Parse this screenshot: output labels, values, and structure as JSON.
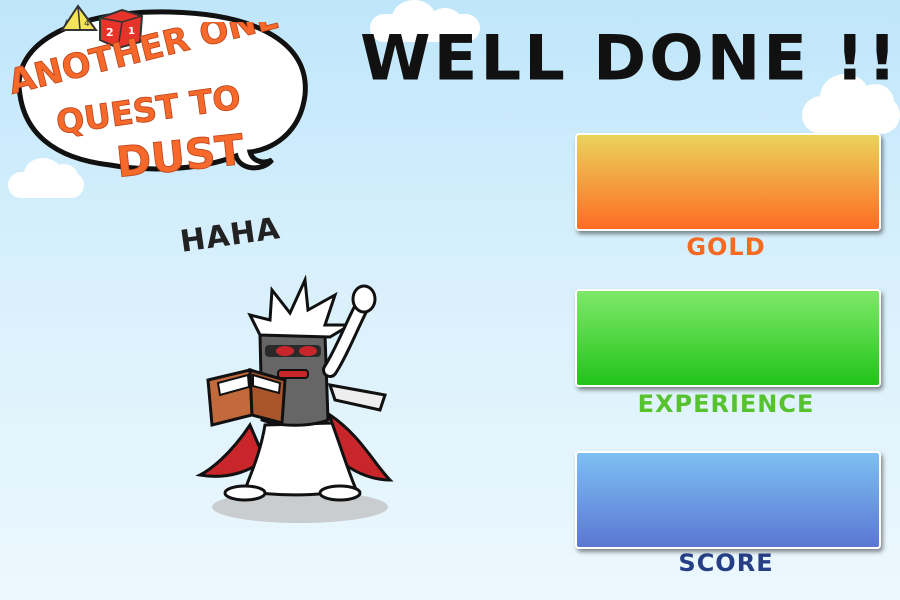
{
  "logo": {
    "line1": "ANOTHER ONE",
    "line2": "QUEST TO",
    "line3": "DUST",
    "dice": [
      "4",
      "2",
      "1"
    ]
  },
  "title": "WELL DONE !!",
  "character": {
    "speech": "HAHA"
  },
  "rewards": [
    {
      "label": "GOLD",
      "label_color": "#f56a22"
    },
    {
      "label": "EXPERIENCE",
      "label_color": "#56c22e"
    },
    {
      "label": "SCORE",
      "label_color": "#263e86"
    }
  ]
}
